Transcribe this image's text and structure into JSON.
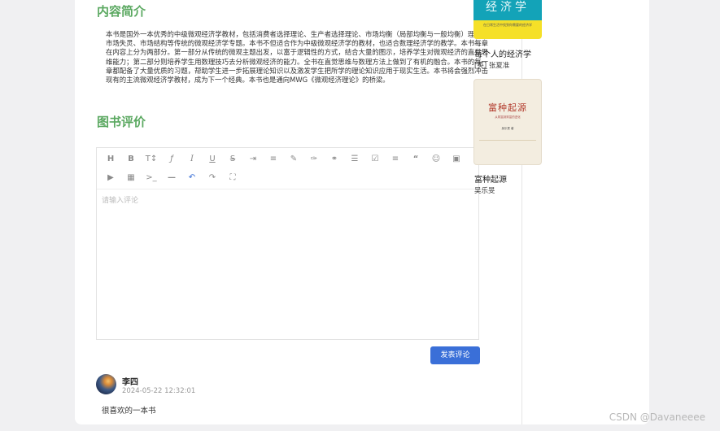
{
  "content": {
    "heading": "内容简介",
    "description": "本书是国外一本优秀的中级微观经济学教材，包括消费者选择理论、生产者选择理论、市场均衡（局部均衡与一般均衡）理论、市场失灵、市场结构等传统的微观经济学专题。本书不但适合作为中级微观经济学的教材，也适合数理经济学的教学。本书每章在内容上分为两部分。第一部分从传统的微观主题出发，以富于逻辑性的方式，结合大量的图示，培养学生对微观经济的直觉思维能力；第二部分则培养学生用数理技巧去分析微观经济的能力。全书在直觉思维与数理方法上做到了有机的融合。本书的每一章都配备了大量优质的习题，帮助学生进一步拓展理论知识以及激发学生把所学的理论知识应用于现实生活。本书将会强烈冲击现有的主流微观经济学教材，成为下一个经典。本书也是通向MWG《微观经济理论》的桥梁。"
  },
  "review": {
    "heading": "图书评价",
    "placeholder": "请输入评论",
    "submit_label": "发表评论",
    "toolbar_icons": [
      "heading-icon",
      "bold-icon",
      "text-size-icon",
      "strikethrough-f-icon",
      "italic-icon",
      "underline-icon",
      "strikethrough-icon",
      "indent-icon",
      "align-icon",
      "highlight-icon",
      "brush-icon",
      "link-icon",
      "list-icon",
      "checkbox-icon",
      "align-left-icon",
      "quote-icon",
      "emoji-icon",
      "image-icon",
      "video-icon",
      "table-icon",
      "code-icon",
      "hr-icon",
      "undo-icon",
      "redo-icon",
      "fullscreen-icon"
    ]
  },
  "comment": {
    "name": "李四",
    "time": "2024-05-22 12:32:01",
    "text": "很喜欢的一本书"
  },
  "sidebar": {
    "books": [
      {
        "cover_title": "经济学",
        "cover_sub": "在日常生活中找到你需要的经济学",
        "title": "每个人的经济学",
        "author": "[英] 张夏准"
      },
      {
        "cover_title": "富种起源",
        "cover_sub": "从财富到财富的进化",
        "cover_author": "吴乐旻 著",
        "title": "富种起源",
        "author": "吴乐旻"
      }
    ]
  },
  "colors": {
    "heading": "#5aa860",
    "button": "#3a6fd8"
  },
  "watermark": "CSDN @Davaneeee"
}
